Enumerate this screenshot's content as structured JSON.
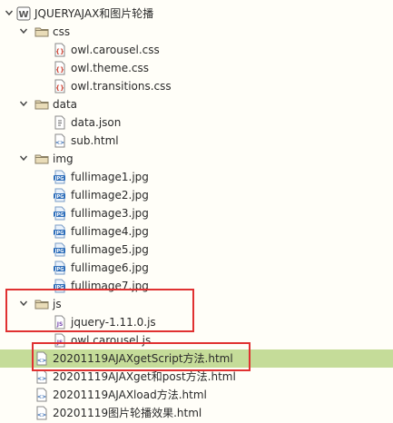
{
  "tree": {
    "project": {
      "label": "JQUERYAJAX和图片轮播",
      "icon": "web-project-icon",
      "expanded": true
    },
    "css_folder": {
      "label": "css",
      "icon": "folder-icon",
      "expanded": true
    },
    "css_files": [
      {
        "label": "owl.carousel.css",
        "icon": "css-file-icon"
      },
      {
        "label": "owl.theme.css",
        "icon": "css-file-icon"
      },
      {
        "label": "owl.transitions.css",
        "icon": "css-file-icon"
      }
    ],
    "data_folder": {
      "label": "data",
      "icon": "folder-icon",
      "expanded": true
    },
    "data_files": [
      {
        "label": "data.json",
        "icon": "json-file-icon"
      },
      {
        "label": "sub.html",
        "icon": "html-file-icon"
      }
    ],
    "img_folder": {
      "label": "img",
      "icon": "folder-icon",
      "expanded": true
    },
    "img_files": [
      {
        "label": "fullimage1.jpg",
        "icon": "jpg-file-icon"
      },
      {
        "label": "fullimage2.jpg",
        "icon": "jpg-file-icon"
      },
      {
        "label": "fullimage3.jpg",
        "icon": "jpg-file-icon"
      },
      {
        "label": "fullimage4.jpg",
        "icon": "jpg-file-icon"
      },
      {
        "label": "fullimage5.jpg",
        "icon": "jpg-file-icon"
      },
      {
        "label": "fullimage6.jpg",
        "icon": "jpg-file-icon"
      },
      {
        "label": "fullimage7.jpg",
        "icon": "jpg-file-icon"
      }
    ],
    "js_folder": {
      "label": "js",
      "icon": "folder-icon",
      "expanded": true
    },
    "js_files": [
      {
        "label": "jquery-1.11.0.js",
        "icon": "js-file-icon"
      },
      {
        "label": "owl.carousel.js",
        "icon": "js-file-icon"
      }
    ],
    "root_files": [
      {
        "label": "20201119AJAXgetScript方法.html",
        "icon": "html-file-icon",
        "selected": true
      },
      {
        "label": "20201119AJAXget和post方法.html",
        "icon": "html-file-icon"
      },
      {
        "label": "20201119AJAXload方法.html",
        "icon": "html-file-icon"
      },
      {
        "label": "20201119图片轮播效果.html",
        "icon": "html-file-icon"
      }
    ]
  },
  "colors": {
    "background": "#fffef8",
    "selection": "#c5dc99",
    "highlight_box": "#e03131",
    "folder": "#8a7f63",
    "css_icon": "#d04a3a",
    "html_icon": "#3a6fb5",
    "jpg_icon": "#2f6fba",
    "js_icon": "#7a4bb0"
  }
}
